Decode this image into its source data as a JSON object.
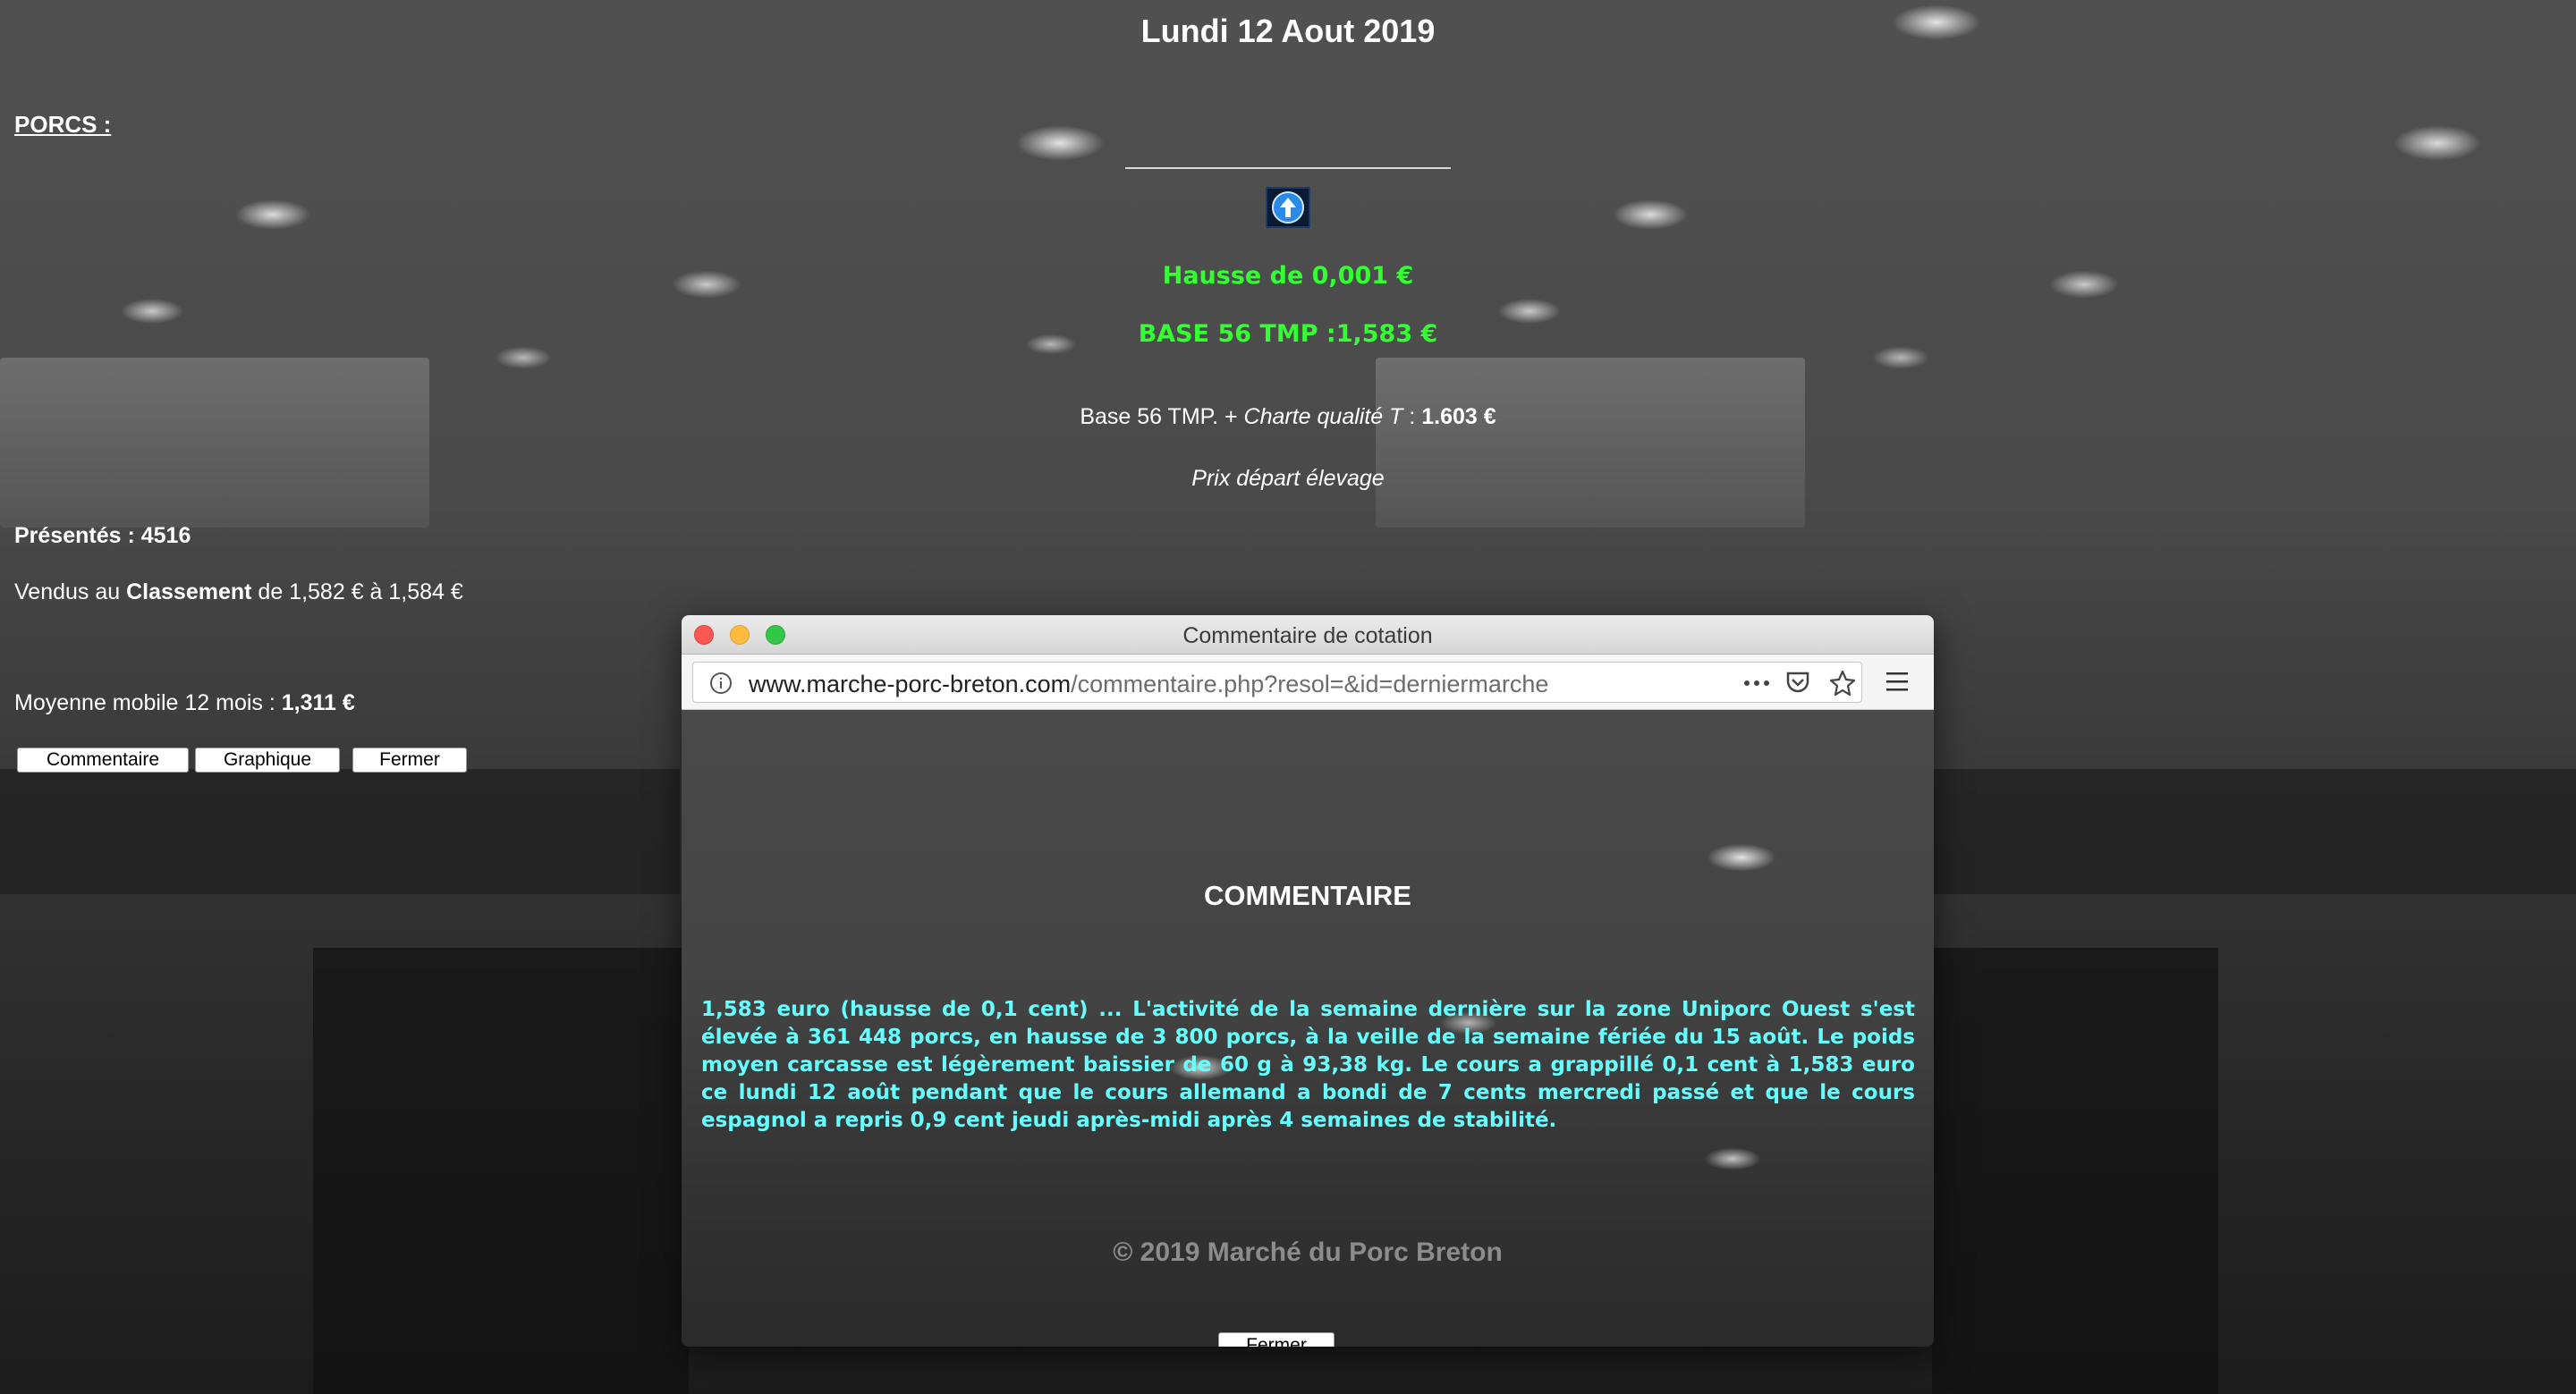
{
  "page": {
    "date": "Lundi 12 Aout 2019",
    "section_title": "PORCS :",
    "change_text": "Hausse de 0,001 €",
    "base_price": "BASE 56 TMP :1,583 €",
    "charte_prefix": "Base 56 TMP. + ",
    "charte_label": "Charte qualité T",
    "charte_sep": " : ",
    "charte_value": "1.603 €",
    "prix_depart": "Prix départ élevage",
    "presentes_label": "Présentés : ",
    "presentes_value": "4516",
    "vendus_prefix": "Vendus au ",
    "vendus_label": "Classement",
    "vendus_range": " de 1,582 € à 1,584 €",
    "moyenne_label": "Moyenne mobile 12 mois : ",
    "moyenne_value": "1,311 €",
    "buttons": {
      "commentaire": "Commentaire",
      "graphique": "Graphique",
      "fermer": "Fermer"
    }
  },
  "popup": {
    "window_title": "Commentaire de cotation",
    "url_domain": "www.marche-porc-breton.com",
    "url_path": "/commentaire.php?resol=&id=derniermarche",
    "heading": "COMMENTAIRE",
    "comment": "1,583 euro (hausse de 0,1 cent) ... L'activité de la semaine dernière sur la zone Uniporc Ouest s'est élevée à 361 448 porcs, en hausse de 3 800 porcs, à la veille de la semaine fériée du 15 août. Le poids moyen carcasse est légèrement baissier de 60 g à 93,38 kg. Le cours a grappillé 0,1 cent à 1,583 euro ce lundi 12 août pendant que le cours allemand a bondi de 7 cents mercredi passé et que le cours espagnol a repris 0,9 cent jeudi après-midi après 4 semaines de stabilité.",
    "copyright": "© 2019 Marché du Porc Breton",
    "close_label": "Fermer"
  },
  "colors": {
    "green": "#33ff33",
    "cyan": "#66ffff",
    "traffic_close": "#fc5753",
    "traffic_min": "#fdbc40",
    "traffic_max": "#33c748"
  },
  "icons": [
    "up-arrow-icon",
    "info-icon",
    "more-icon",
    "pocket-icon",
    "star-icon",
    "menu-icon"
  ]
}
